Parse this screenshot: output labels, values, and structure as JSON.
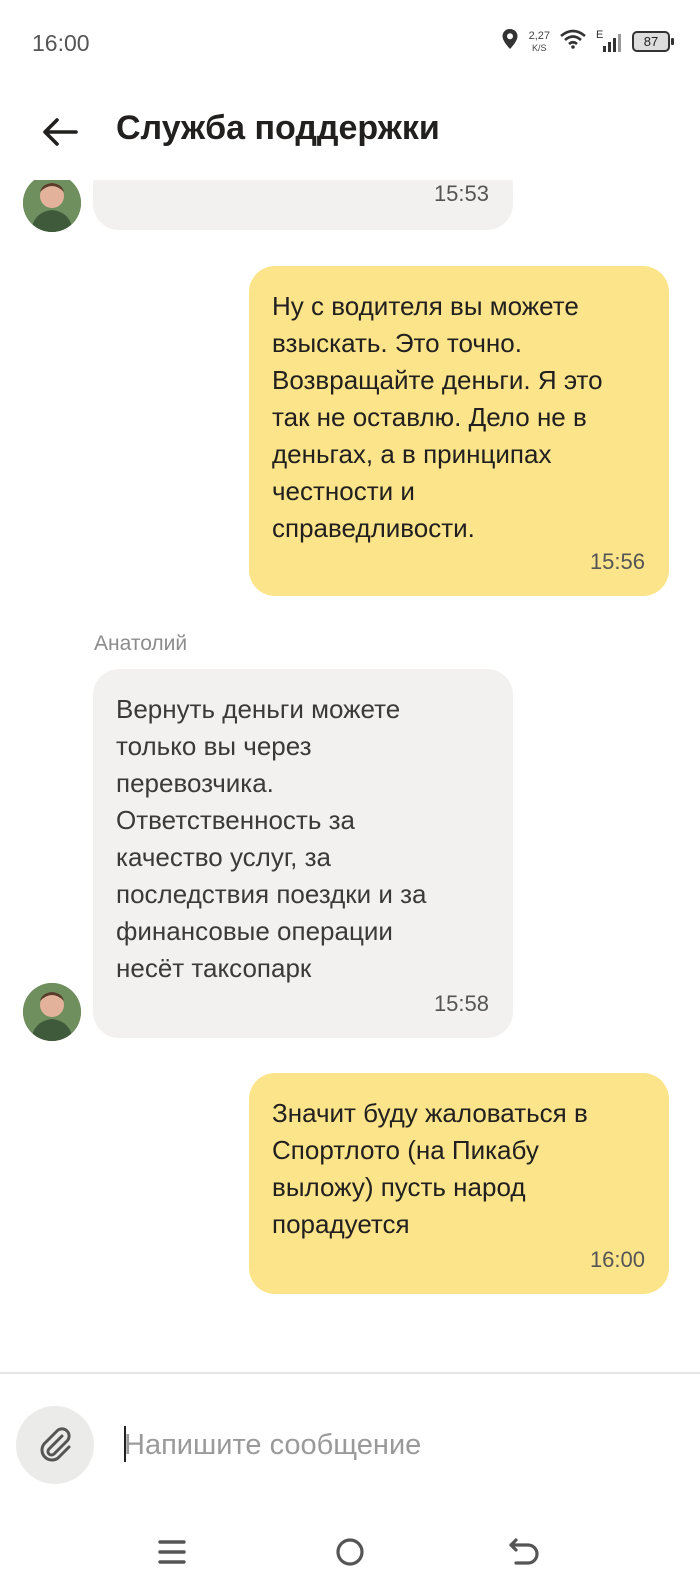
{
  "status_bar": {
    "time": "16:00",
    "net_speed_value": "2,27",
    "net_speed_unit": "K/S",
    "network_type": "E",
    "battery": "87"
  },
  "header": {
    "title": "Служба поддержки",
    "back_icon": "arrow-left-icon"
  },
  "messages": [
    {
      "direction": "incoming",
      "text": "",
      "time": "15:53"
    },
    {
      "direction": "outgoing",
      "text": "Ну с водителя вы можете\nвзыскать. Это точно.\nВозвращайте деньги. Я это\nтак не оставлю. Дело не в\nденьгах, а в принципах\nчестности и\nсправедливости.",
      "time": "15:56"
    },
    {
      "direction": "incoming",
      "sender": "Анатолий",
      "text": "Вернуть деньги можете\nтолько вы через\nперевозчика.\nОтветственность за\nкачество услуг, за\nпоследствия поездки и за\nфинансовые операции\nнесёт таксопарк",
      "time": "15:58"
    },
    {
      "direction": "outgoing",
      "text": "Значит буду жаловаться в\nСпортлото (на Пикабу\nвыложу) пусть народ\nпорадуется",
      "time": "16:00"
    }
  ],
  "composer": {
    "placeholder": "Напишите сообщение",
    "value": "",
    "attach_icon": "paperclip-icon"
  },
  "nav": {
    "menu_icon": "menu-icon",
    "home_icon": "home-circle-icon",
    "back_icon": "back-gesture-icon"
  }
}
